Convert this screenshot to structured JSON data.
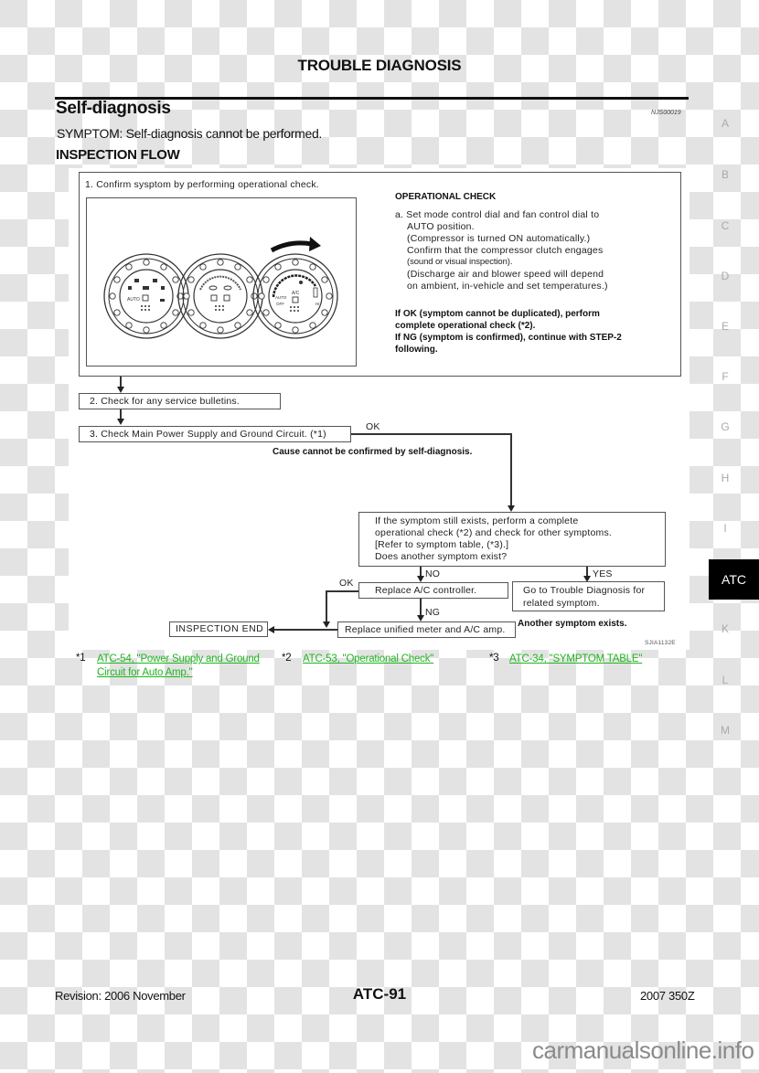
{
  "header": {
    "page_title": "TROUBLE DIAGNOSIS",
    "section_title": "Self-diagnosis",
    "ref_code": "NJS00019",
    "symptom": "SYMPTOM: Self-diagnosis cannot be performed.",
    "flow_title": "INSPECTION FLOW"
  },
  "diagram": {
    "step1": "1. Confirm sysptom by performing operational check.",
    "dial_labels": {
      "auto": "AUTO",
      "ac": "A/C",
      "auto_off_1": "AUTO",
      "auto_off_2": "OFF",
      "hi": "HI"
    },
    "operational_check": {
      "title": "OPERATIONAL CHECK",
      "lines": [
        "a. Set mode control dial and fan control dial to",
        "AUTO position.",
        "(Compressor is turned ON automatically.)",
        "Confirm that the compressor clutch engages",
        "(sound or visual inspection).",
        "(Discharge air and blower speed will depend",
        "on ambient, in-vehicle and set temperatures.)"
      ],
      "result_lines": [
        "If OK (symptom cannot be duplicated), perform",
        "complete operational check (*2).",
        "If NG (symptom is confirmed), continue with STEP-2",
        "following."
      ]
    },
    "step2": "2. Check for any service bulletins.",
    "step3": "3. Check Main Power Supply and Ground Circuit. (*1)",
    "ok_label": "OK",
    "cause_note": "Cause cannot be confirmed by self-diagnosis.",
    "symptom_box_lines": [
      "If the symptom still exists, perform a complete",
      "operational check (*2) and check for other symptoms.",
      "[Refer to symptom table, (*3).]",
      "Does another symptom exist?"
    ],
    "no_label": "NO",
    "yes_label": "YES",
    "replace_controller": "Replace A/C controller.",
    "goto_trouble_lines": [
      "Go to Trouble Diagnosis for",
      "related symptom."
    ],
    "ok_label_2": "OK",
    "ng_label": "NG",
    "replace_meter": "Replace unified meter and A/C amp.",
    "inspection_end": "INSPECTION END",
    "another_symptom": "Another symptom exists.",
    "figure_code": "SJIA1132E"
  },
  "footnotes": [
    {
      "mark": "*1",
      "lines": [
        "ATC-54, \"Power Supply and Ground ",
        "Circuit for Auto Amp.\""
      ]
    },
    {
      "mark": "*2",
      "lines": [
        "ATC-53, \"Operational Check\""
      ]
    },
    {
      "mark": "*3",
      "lines": [
        "ATC-34, \"SYMPTOM TABLE\""
      ]
    }
  ],
  "link_color": "#1fb51f",
  "side_index": {
    "letters": [
      "A",
      "B",
      "C",
      "D",
      "E",
      "F",
      "G",
      "H",
      "I",
      "K",
      "L",
      "M"
    ],
    "active_tab": "ATC"
  },
  "footer": {
    "revision": "Revision: 2006 November",
    "page_number": "ATC-91",
    "model": "2007 350Z",
    "watermark": "carmanualsonline.info"
  }
}
